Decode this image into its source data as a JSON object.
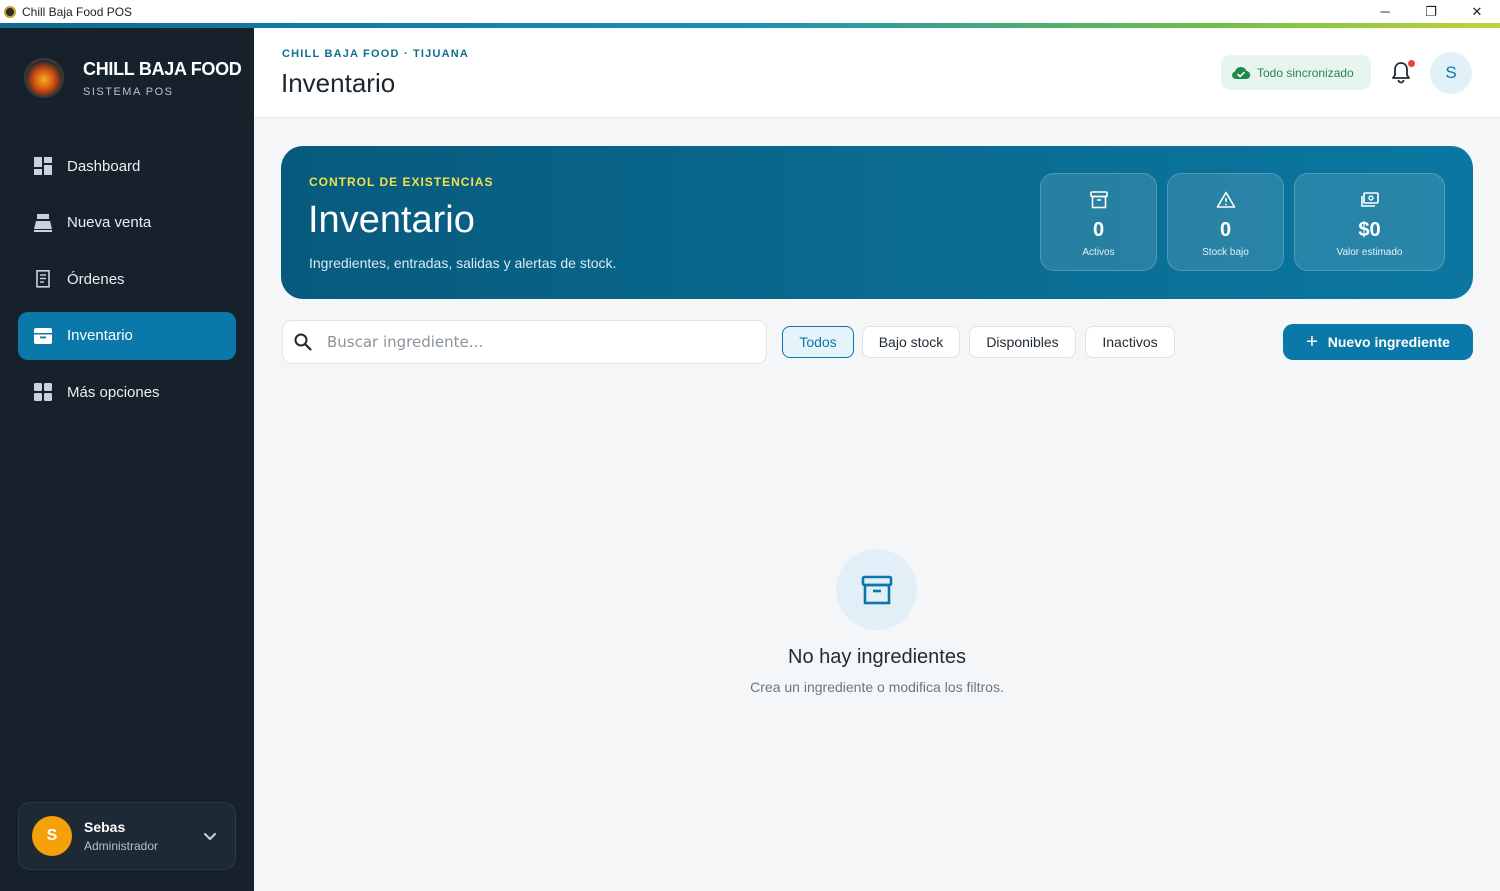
{
  "window": {
    "title": "Chill Baja Food POS",
    "controls": {
      "minimize": "─",
      "restore": "❐",
      "close": "✕"
    }
  },
  "sidebar": {
    "brand_name": "CHILL BAJA FOOD",
    "brand_sub": "SISTEMA POS",
    "items": [
      {
        "label": "Dashboard",
        "icon": "dashboard-icon",
        "active": false
      },
      {
        "label": "Nueva venta",
        "icon": "register-icon",
        "active": false
      },
      {
        "label": "Órdenes",
        "icon": "receipt-icon",
        "active": false
      },
      {
        "label": "Inventario",
        "icon": "archive-icon",
        "active": true
      },
      {
        "label": "Más opciones",
        "icon": "grid-icon",
        "active": false
      }
    ],
    "user": {
      "initial": "S",
      "name": "Sebas",
      "role": "Administrador"
    }
  },
  "header": {
    "breadcrumb": "CHILL BAJA FOOD · TIJUANA",
    "title": "Inventario",
    "sync_status": "Todo sincronizado",
    "avatar_initial": "S"
  },
  "hero": {
    "kicker": "CONTROL DE EXISTENCIAS",
    "title": "Inventario",
    "description": "Ingredientes, entradas, salidas y alertas de stock.",
    "stats": [
      {
        "value": "0",
        "label": "Activos",
        "icon": "archive-icon"
      },
      {
        "value": "0",
        "label": "Stock bajo",
        "icon": "warning-icon"
      },
      {
        "value": "$0",
        "label": "Valor estimado",
        "icon": "cash-icon"
      }
    ]
  },
  "toolbar": {
    "search_placeholder": "Buscar ingrediente...",
    "filters": [
      {
        "label": "Todos",
        "active": true
      },
      {
        "label": "Bajo stock",
        "active": false
      },
      {
        "label": "Disponibles",
        "active": false
      },
      {
        "label": "Inactivos",
        "active": false
      }
    ],
    "new_button": "Nuevo ingrediente",
    "new_button_icon": "+"
  },
  "empty_state": {
    "title": "No hay ingredientes",
    "description": "Crea un ingrediente o modifica los filtros."
  },
  "colors": {
    "accent": "#0a78a8",
    "sidebar_bg": "#17212b",
    "kicker": "#f2e14c",
    "sync_green": "#1e8a4f",
    "user_avatar": "#f5a20a"
  }
}
